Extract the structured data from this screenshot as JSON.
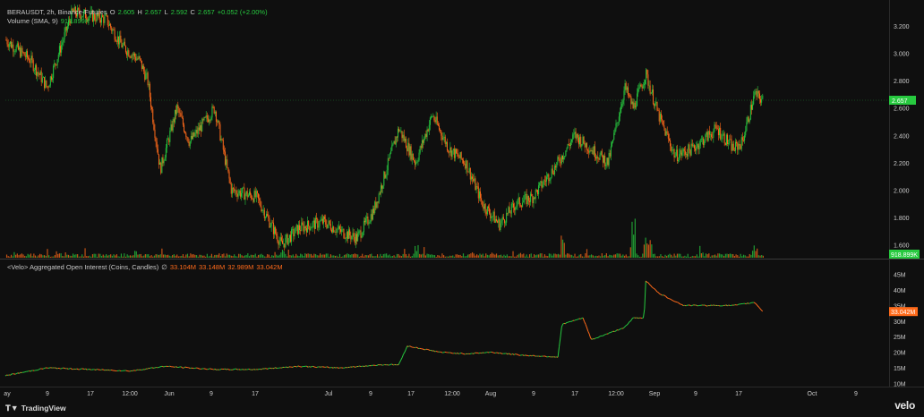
{
  "header": {
    "symbol": "BERAUSDT, 2h, Binance-Futures",
    "o_label": "O",
    "o_val": "2.605",
    "h_label": "H",
    "h_val": "2.657",
    "l_label": "L",
    "l_val": "2.592",
    "c_label": "C",
    "c_val": "2.657",
    "change": "+0.052 (+2.00%)",
    "volume_label": "Volume (SMA, 9)",
    "volume_val": "918.899K"
  },
  "oi_legend": {
    "label": "<Velo> Aggregated Open Interest (Coins, Candles)",
    "icon": "∅",
    "o": "33.104M",
    "h": "33.148M",
    "l": "32.989M",
    "c": "33.042M"
  },
  "branding": {
    "tradingview": "TradingView",
    "velo": "velo"
  },
  "colors": {
    "up": "#27c93f",
    "down": "#ff6a1a",
    "background": "#0f0f0f",
    "axis_text": "#c9c9c9"
  },
  "chart_data": [
    {
      "type": "candlestick",
      "title": "BERAUSDT, 2h, Binance-Futures",
      "ylim": [
        1.5,
        3.35
      ],
      "y_ticks": [
        "3.200",
        "3.000",
        "2.800",
        "2.600",
        "2.400",
        "2.200",
        "2.000",
        "1.800",
        "1.600"
      ],
      "last_price_label": "2.657",
      "last_price": 2.657,
      "approx_close_path": [
        {
          "x": 0,
          "y": 3.1
        },
        {
          "x": 3,
          "y": 2.95
        },
        {
          "x": 5,
          "y": 2.75
        },
        {
          "x": 8,
          "y": 3.3
        },
        {
          "x": 12,
          "y": 3.25
        },
        {
          "x": 14,
          "y": 3.05
        },
        {
          "x": 16,
          "y": 2.95
        },
        {
          "x": 17,
          "y": 2.8
        },
        {
          "x": 18.5,
          "y": 2.15
        },
        {
          "x": 20.5,
          "y": 2.6
        },
        {
          "x": 22,
          "y": 2.35
        },
        {
          "x": 25,
          "y": 2.6
        },
        {
          "x": 27,
          "y": 2.0
        },
        {
          "x": 30,
          "y": 1.95
        },
        {
          "x": 33,
          "y": 1.6
        },
        {
          "x": 35,
          "y": 1.72
        },
        {
          "x": 38,
          "y": 1.77
        },
        {
          "x": 40,
          "y": 1.7
        },
        {
          "x": 42,
          "y": 1.65
        },
        {
          "x": 44,
          "y": 1.85
        },
        {
          "x": 47,
          "y": 2.45
        },
        {
          "x": 49,
          "y": 2.2
        },
        {
          "x": 51,
          "y": 2.55
        },
        {
          "x": 53,
          "y": 2.3
        },
        {
          "x": 55,
          "y": 2.2
        },
        {
          "x": 57,
          "y": 1.9
        },
        {
          "x": 59,
          "y": 1.75
        },
        {
          "x": 61,
          "y": 1.9
        },
        {
          "x": 63,
          "y": 1.95
        },
        {
          "x": 66,
          "y": 2.2
        },
        {
          "x": 68,
          "y": 2.4
        },
        {
          "x": 70,
          "y": 2.3
        },
        {
          "x": 72,
          "y": 2.2
        },
        {
          "x": 74,
          "y": 2.75
        },
        {
          "x": 75,
          "y": 2.6
        },
        {
          "x": 76.5,
          "y": 2.85
        },
        {
          "x": 78,
          "y": 2.55
        },
        {
          "x": 80,
          "y": 2.25
        },
        {
          "x": 82,
          "y": 2.3
        },
        {
          "x": 85,
          "y": 2.45
        },
        {
          "x": 87,
          "y": 2.3
        },
        {
          "x": 88,
          "y": 2.35
        },
        {
          "x": 89.5,
          "y": 2.7
        },
        {
          "x": 90.5,
          "y": 2.657
        }
      ]
    },
    {
      "type": "bar",
      "title": "Volume (SMA, 9)",
      "last_value_label": "918.899K"
    },
    {
      "type": "line",
      "title": "<Velo> Aggregated Open Interest (Coins, Candles)",
      "ylim": [
        9,
        46
      ],
      "y_ticks": [
        "45M",
        "40M",
        "35M",
        "30M",
        "25M",
        "20M",
        "15M",
        "10M"
      ],
      "last_value_label": "33.042M",
      "last_value": 33.042,
      "approx_path": [
        {
          "x": 0,
          "y": 12.5
        },
        {
          "x": 5,
          "y": 15
        },
        {
          "x": 10,
          "y": 14.5
        },
        {
          "x": 15,
          "y": 14
        },
        {
          "x": 19,
          "y": 15.5
        },
        {
          "x": 25,
          "y": 14.5
        },
        {
          "x": 30,
          "y": 14.5
        },
        {
          "x": 35,
          "y": 15.5
        },
        {
          "x": 40,
          "y": 15
        },
        {
          "x": 45,
          "y": 16
        },
        {
          "x": 47,
          "y": 16
        },
        {
          "x": 48,
          "y": 22
        },
        {
          "x": 52,
          "y": 20
        },
        {
          "x": 55,
          "y": 19.5
        },
        {
          "x": 58,
          "y": 20
        },
        {
          "x": 62,
          "y": 19
        },
        {
          "x": 66,
          "y": 18.5
        },
        {
          "x": 66.5,
          "y": 29
        },
        {
          "x": 69,
          "y": 31
        },
        {
          "x": 70,
          "y": 24
        },
        {
          "x": 72,
          "y": 26
        },
        {
          "x": 74,
          "y": 28
        },
        {
          "x": 75,
          "y": 31
        },
        {
          "x": 76.3,
          "y": 31
        },
        {
          "x": 76.5,
          "y": 43
        },
        {
          "x": 78,
          "y": 39
        },
        {
          "x": 81,
          "y": 35
        },
        {
          "x": 84,
          "y": 35
        },
        {
          "x": 87,
          "y": 35
        },
        {
          "x": 89.5,
          "y": 36
        },
        {
          "x": 90.5,
          "y": 33.042
        }
      ]
    },
    {
      "type": "time_axis",
      "x_ticks": [
        "ay",
        "9",
        "17",
        "12:00",
        "Jun",
        "9",
        "17",
        "Jul",
        "9",
        "17",
        "12:00",
        "Aug",
        "9",
        "17",
        "12:00",
        "Sep",
        "9",
        "17",
        "Oct",
        "9"
      ]
    }
  ]
}
